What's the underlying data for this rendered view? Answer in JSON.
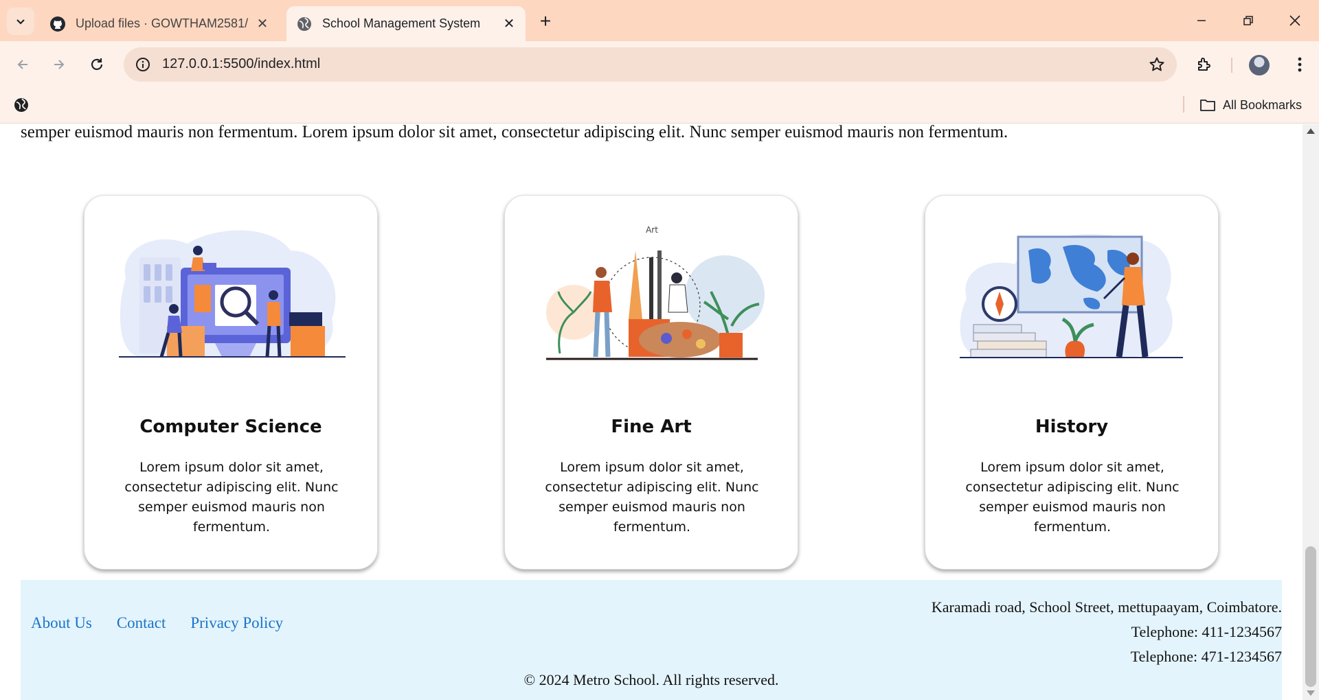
{
  "browser": {
    "tabs": [
      {
        "title": "Upload files · GOWTHAM2581/"
      },
      {
        "title": "School Management System"
      }
    ],
    "url": "127.0.0.1:5500/index.html",
    "bookmarks_label": "All Bookmarks"
  },
  "page": {
    "intro_text": "semper euismod mauris non fermentum. Lorem ipsum dolor sit amet, consectetur adipiscing elit. Nunc semper euismod mauris non fermentum.",
    "cards": [
      {
        "title": "Computer Science",
        "body": "Lorem ipsum dolor sit amet, consectetur adipiscing elit. Nunc semper euismod mauris non fermentum."
      },
      {
        "title": "Fine Art",
        "art_label": "Art",
        "body": "Lorem ipsum dolor sit amet, consectetur adipiscing elit. Nunc semper euismod mauris non fermentum."
      },
      {
        "title": "History",
        "body": "Lorem ipsum dolor sit amet, consectetur adipiscing elit. Nunc semper euismod mauris non fermentum."
      }
    ],
    "footer": {
      "links": [
        "About Us",
        "Contact",
        "Privacy Policy"
      ],
      "address": "Karamadi road, School Street, mettupaayam, Coimbatore.",
      "phone1": "Telephone: 411-1234567",
      "phone2": "Telephone: 471-1234567",
      "copyright": "© 2024 Metro School. All rights reserved."
    }
  },
  "colors": {
    "tabstrip": "#fed7c0",
    "toolbar": "#fdf1ea",
    "footer_bg": "#e4f4fd",
    "link": "#1a73c8"
  }
}
